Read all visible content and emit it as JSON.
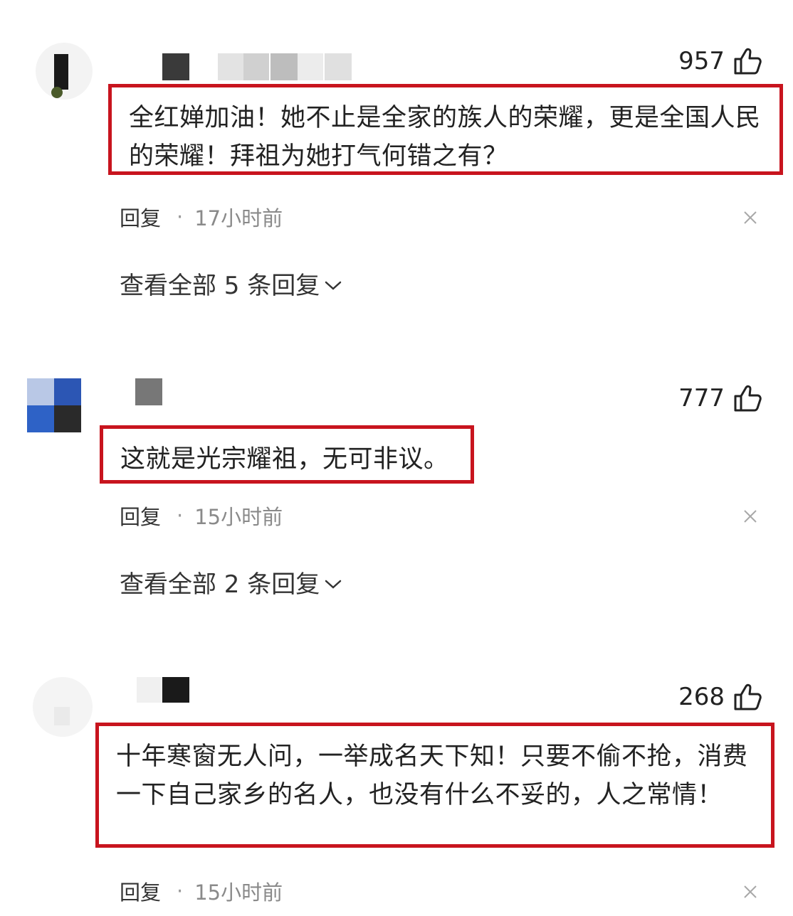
{
  "comments": [
    {
      "likes": "957",
      "text": "全红婵加油！她不止是全家的族人的荣耀，更是全国人民的荣耀！拜祖为她打气何错之有？",
      "reply_label": "回复",
      "dot": "·",
      "time": "17小时前",
      "view_all": "查看全部 5 条回复"
    },
    {
      "likes": "777",
      "text": "这就是光宗耀祖，无可非议。",
      "reply_label": "回复",
      "dot": "·",
      "time": "15小时前",
      "view_all": "查看全部 2 条回复"
    },
    {
      "likes": "268",
      "text": "十年寒窗无人问，一举成名天下知！只要不偷不抢，消费一下自己家乡的名人，也没有什么不妥的，人之常情！",
      "reply_label": "回复",
      "dot": "·",
      "time": "15小时前"
    }
  ],
  "colors": {
    "highlight_border": "#c8141e",
    "meta_gray": "#8a8a8a"
  },
  "icons": {
    "like": "thumbs-up-icon",
    "dismiss": "close-icon",
    "expand": "chevron-down-icon"
  }
}
